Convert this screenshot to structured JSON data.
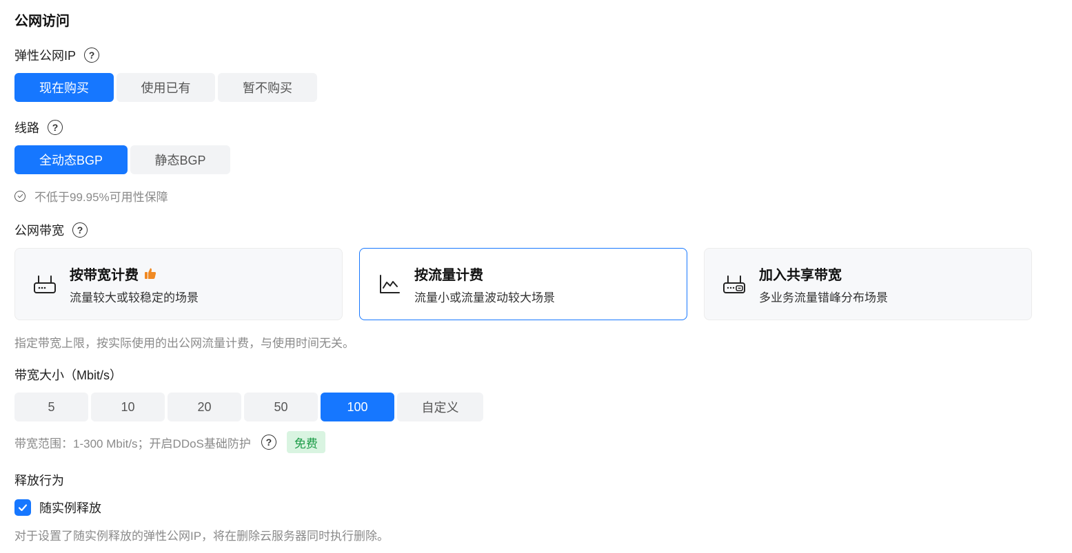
{
  "section_title": "公网访问",
  "eip": {
    "label": "弹性公网IP",
    "help": "?",
    "options": [
      "现在购买",
      "使用已有",
      "暂不购买"
    ],
    "selected": "现在购买"
  },
  "line": {
    "label": "线路",
    "help": "?",
    "options": [
      "全动态BGP",
      "静态BGP"
    ],
    "selected": "全动态BGP",
    "note": "不低于99.95%可用性保障"
  },
  "bandwidth_billing": {
    "label": "公网带宽",
    "help": "?",
    "cards": [
      {
        "title": "按带宽计费",
        "desc": "流量较大或较稳定的场景",
        "icon": "router-icon",
        "recommended": true
      },
      {
        "title": "按流量计费",
        "desc": "流量小或流量波动较大场景",
        "icon": "line-chart-icon",
        "recommended": false
      },
      {
        "title": "加入共享带宽",
        "desc": "多业务流量错峰分布场景",
        "icon": "shared-router-icon",
        "recommended": false
      }
    ],
    "selected": "按流量计费",
    "description": "指定带宽上限，按实际使用的出公网流量计费，与使用时间无关。"
  },
  "bandwidth_size": {
    "label": "带宽大小（Mbit/s）",
    "options": [
      "5",
      "10",
      "20",
      "50",
      "100",
      "自定义"
    ],
    "selected": "100",
    "range_note": "带宽范围：1-300 Mbit/s；开启DDoS基础防护",
    "help": "?",
    "free_tag": "免费"
  },
  "release": {
    "label": "释放行为",
    "checkbox_label": "随实例释放",
    "checked": true,
    "note": "对于设置了随实例释放的弹性公网IP，将在删除云服务器同时执行删除。"
  },
  "colors": {
    "accent": "#1677ff",
    "free_tag_bg": "#d9f4e1",
    "free_tag_text": "#1c9b47",
    "thumb_icon": "#f08a24"
  }
}
